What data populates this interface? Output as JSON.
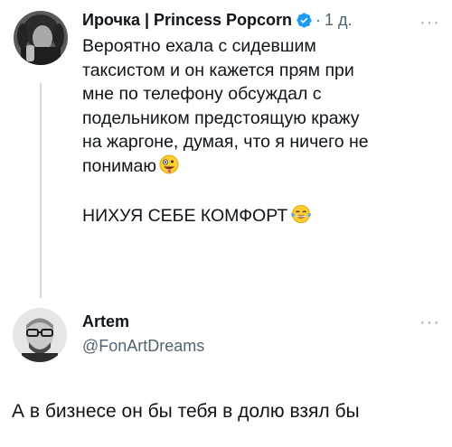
{
  "post": {
    "author_name": "Ирочка | Princess Popcorn",
    "separator": "·",
    "time": "1 д.",
    "more": "···",
    "body_lines": [
      "Вероятно ехала с сидевшим",
      "таксистом и он кажется прям при",
      "мне по телефону обсуждал с",
      "подельником предстоящую кражу",
      "на жаргоне, думая, что я ничего не",
      "понимаю"
    ],
    "second_paragraph": "НИХУЯ СЕБЕ КОМФОРТ",
    "verified_icon": "verified-badge-icon",
    "emoji_1": "zany-face-emoji",
    "emoji_2": "tears-of-joy-emoji",
    "colors": {
      "verified": "#1d9bf0",
      "secondary_text": "#536471",
      "thread_line": "#cfd9de"
    }
  },
  "reply": {
    "author_name": "Artem",
    "handle": "@FonArtDreams",
    "more": "···",
    "text": "А в бизнесе он бы тебя в долю взял бы"
  }
}
